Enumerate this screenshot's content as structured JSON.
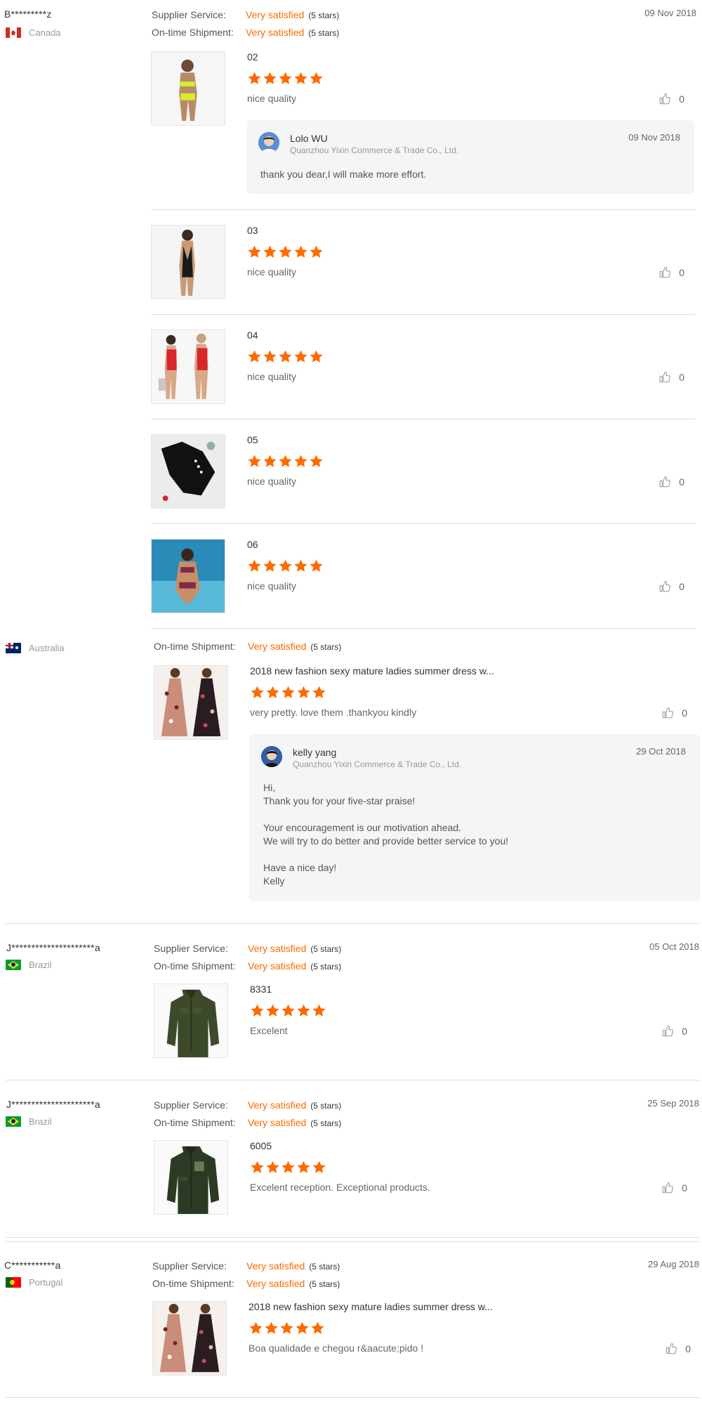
{
  "rating_labels": {
    "supplier_service": "Supplier Service:",
    "shipment": "On-time Shipment:"
  },
  "colors": {
    "accent": "#ff6a00",
    "text": "#333333",
    "muted": "#999999",
    "divider": "#dcdcdc",
    "reply_bg": "#f4f5f7"
  },
  "icons": {
    "star": "star-icon",
    "like": "thumbs-up-icon"
  },
  "reviews": [
    {
      "buyer": "B*********z",
      "country": "Canada",
      "flag": "flag-canada-icon",
      "date": "09 Nov 2018",
      "supplier_service": {
        "value": "Very satisfied",
        "stars": "(5 stars)"
      },
      "shipment": {
        "value": "Very satisfied",
        "stars": "(5 stars)"
      },
      "items": [
        {
          "title": "02",
          "rating": 5,
          "text": "nice quality",
          "likes": "0",
          "reply": {
            "name": "Lolo WU",
            "company": "Quanzhou Yixin Commerce & Trade Co., Ltd.",
            "date": "09 Nov 2018",
            "lines": [
              "thank you dear,I will make more effort."
            ]
          }
        },
        {
          "title": "03",
          "rating": 5,
          "text": "nice quality",
          "likes": "0"
        },
        {
          "title": "04",
          "rating": 5,
          "text": "nice quality",
          "likes": "0"
        },
        {
          "title": "05",
          "rating": 5,
          "text": "nice quality",
          "likes": "0"
        },
        {
          "title": "06",
          "rating": 5,
          "text": "nice quality",
          "likes": "0"
        }
      ]
    },
    {
      "country": "Australia",
      "flag": "flag-australia-icon",
      "shipment": {
        "value": "Very satisfied",
        "stars": "(5 stars)"
      },
      "items": [
        {
          "title": "2018 new fashion sexy mature ladies summer dress w...",
          "rating": 5,
          "text": "very pretty. love them .thankyou  kindly",
          "likes": "0",
          "reply": {
            "name": "kelly yang",
            "company": "Quanzhou Yixin Commerce & Trade Co., Ltd.",
            "date": "29 Oct 2018",
            "lines": [
              "Hi,",
              "Thank you for your five-star praise!",
              "",
              "Your encouragement is our motivation ahead.",
              "We will try to do better and provide better service to you!",
              "",
              "Have a nice day!",
              "Kelly"
            ]
          }
        }
      ]
    },
    {
      "buyer": "J*********************a",
      "country": "Brazil",
      "flag": "flag-brazil-icon",
      "date": "05 Oct 2018",
      "supplier_service": {
        "value": "Very satisfied",
        "stars": "(5 stars)"
      },
      "shipment": {
        "value": "Very satisfied",
        "stars": "(5 stars)"
      },
      "items": [
        {
          "title": "8331",
          "rating": 5,
          "text": "Excelent",
          "likes": "0"
        }
      ]
    },
    {
      "buyer": "J*********************a",
      "country": "Brazil",
      "flag": "flag-brazil-icon",
      "date": "25 Sep 2018",
      "supplier_service": {
        "value": "Very satisfied",
        "stars": "(5 stars)"
      },
      "shipment": {
        "value": "Very satisfied",
        "stars": "(5 stars)"
      },
      "items": [
        {
          "title": "6005",
          "rating": 5,
          "text": "Excelent reception. Exceptional products.",
          "likes": "0"
        }
      ]
    },
    {
      "buyer": "C***********a",
      "country": "Portugal",
      "flag": "flag-portugal-icon",
      "date": "29 Aug 2018",
      "supplier_service": {
        "value": "Very satisfied",
        "stars": "(5 stars)"
      },
      "shipment": {
        "value": "Very satisfied",
        "stars": "(5 stars)"
      },
      "items": [
        {
          "title": "2018 new fashion sexy mature ladies summer dress w...",
          "rating": 5,
          "text": "Boa qualidade e chegou r&aacute;pido !",
          "likes": "0"
        }
      ]
    }
  ]
}
